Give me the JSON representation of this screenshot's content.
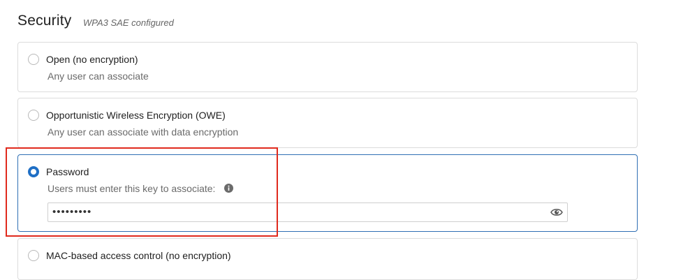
{
  "section": {
    "title": "Security",
    "subtitle": "WPA3 SAE configured"
  },
  "options": [
    {
      "label": "Open (no encryption)",
      "description": "Any user can associate",
      "selected": false
    },
    {
      "label": "Opportunistic Wireless Encryption (OWE)",
      "description": "Any user can associate with data encryption",
      "selected": false
    },
    {
      "label": "Password",
      "description": "Users must enter this key to associate:",
      "selected": true
    },
    {
      "label": "MAC-based access control (no encryption)",
      "selected": false
    }
  ],
  "password_field": {
    "value": "•••••••••"
  },
  "icons": {
    "info": "info-icon",
    "eye": "eye-icon"
  },
  "colors": {
    "accent": "#1f6fc5",
    "highlight": "#e02a1d"
  }
}
